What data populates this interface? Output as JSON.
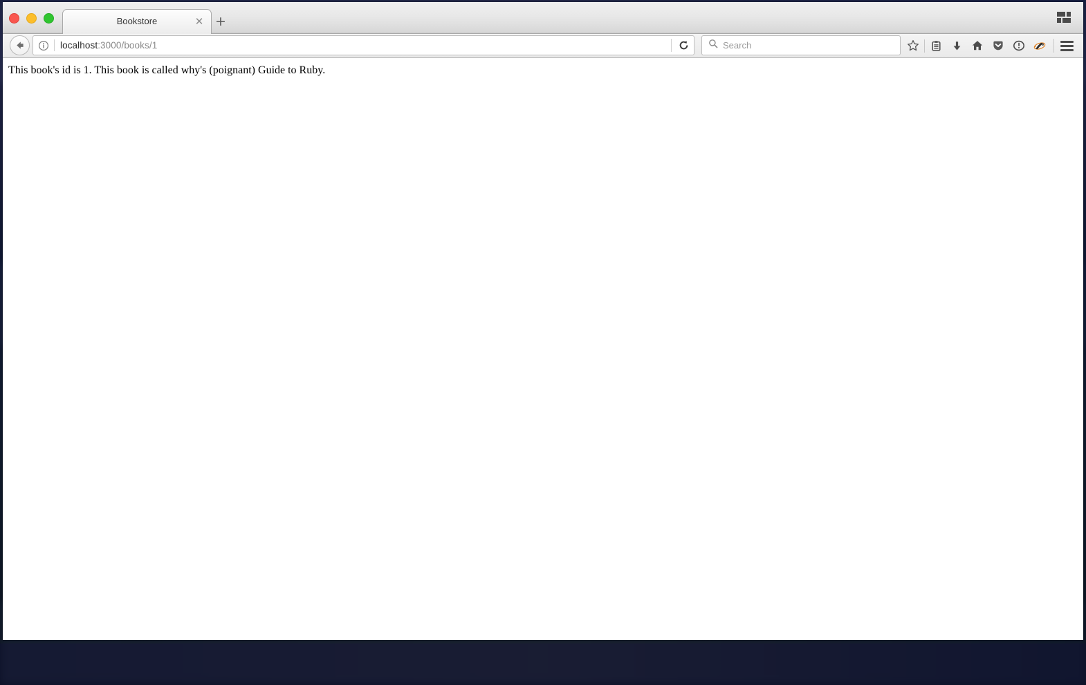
{
  "window": {
    "traffic_lights": [
      {
        "name": "close",
        "color": "#f9564f"
      },
      {
        "name": "minimize",
        "color": "#fcbe2b"
      },
      {
        "name": "zoom",
        "color": "#2fc52f"
      }
    ]
  },
  "tabstrip": {
    "tabs": [
      {
        "title": "Bookstore",
        "close_label": "✕",
        "active": true
      }
    ],
    "new_tab_label": "+",
    "tab_overview_icon": "grid-icon"
  },
  "navbar": {
    "back_icon": "back-arrow-icon",
    "url": {
      "identity_icon": "info-circle-icon",
      "host": "localhost",
      "path": ":3000/books/1",
      "full": "localhost:3000/books/1",
      "reload_icon": "reload-icon"
    },
    "search": {
      "icon": "search-icon",
      "placeholder": "Search",
      "value": ""
    },
    "toolbar_icons": [
      {
        "name": "bookmark-star-icon",
        "title": "Bookmark this page"
      },
      {
        "name": "library-icon",
        "title": "Library"
      },
      {
        "name": "downloads-icon",
        "title": "Downloads"
      },
      {
        "name": "home-icon",
        "title": "Home"
      },
      {
        "name": "pocket-icon",
        "title": "Save to Pocket"
      },
      {
        "name": "info-alert-icon",
        "title": "Page info"
      },
      {
        "name": "addon-badger-icon",
        "title": "Privacy Badger"
      }
    ],
    "menu_icon": "hamburger-menu-icon"
  },
  "content": {
    "body_text": "This book's id is 1. This book is called why's (poignant) Guide to Ruby.",
    "book_id": "1",
    "book_title": "why's (poignant) Guide to Ruby"
  },
  "colors": {
    "chrome_light": "#f0f0f0",
    "chrome_dark": "#d8d8d8",
    "page_background": "#ffffff",
    "desktop": "#101a2c",
    "icon_gray": "#4c4c4c"
  }
}
